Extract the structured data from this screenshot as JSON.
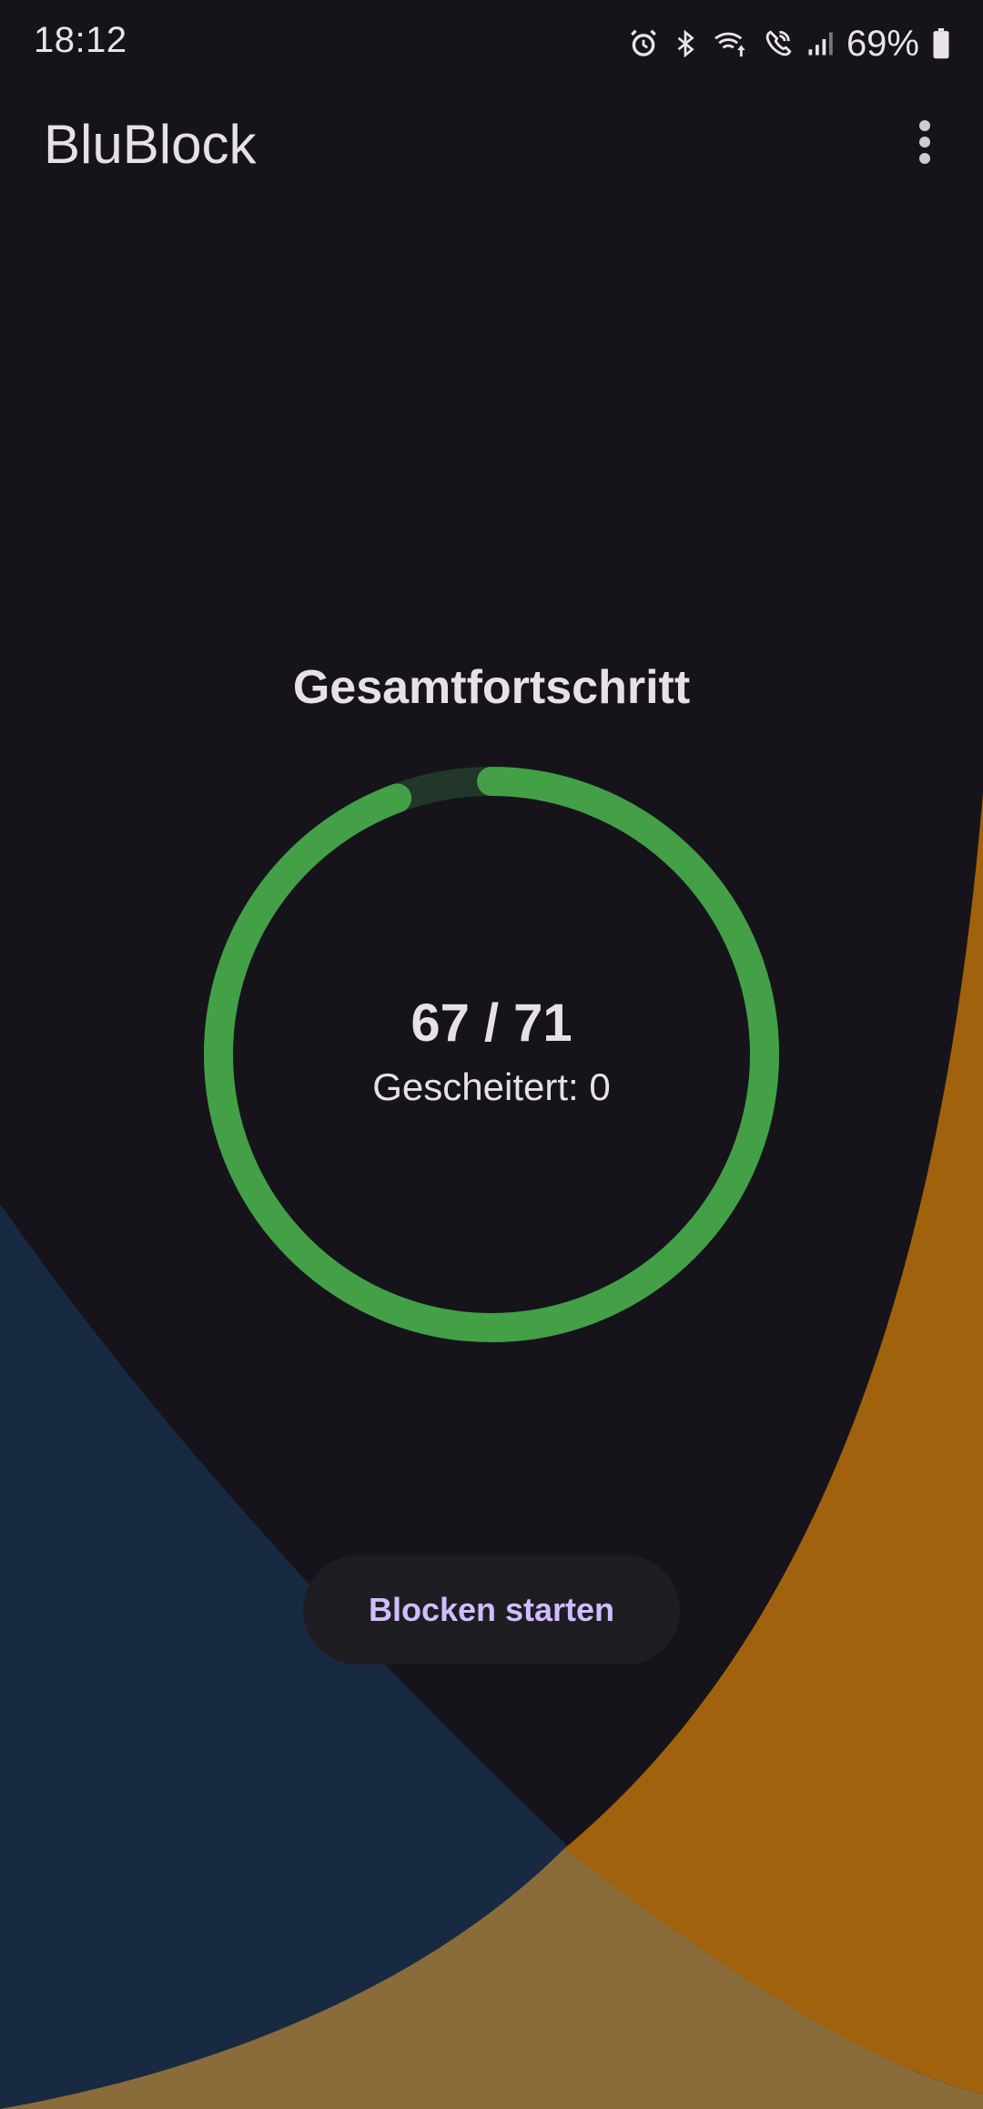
{
  "status_bar": {
    "time": "18:12",
    "battery_percent": "69%",
    "icons": [
      "alarm-icon",
      "bluetooth-icon",
      "wifi-calling-icon",
      "volte-call-icon",
      "signal-icon",
      "battery-icon"
    ]
  },
  "app_bar": {
    "title": "BluBlock",
    "menu_icon": "more-vert-icon"
  },
  "progress": {
    "title": "Gesamtfortschritt",
    "count": "67 / 71",
    "failed": "Gescheitert: 0",
    "completed": 67,
    "total": 71,
    "color": "#43a047",
    "track_color": "#22362a"
  },
  "actions": {
    "start_label": "Blocken starten"
  },
  "colors": {
    "background": "#16141a",
    "left_wave": "#172a42",
    "right_wave": "#a0620c",
    "bottom_wave": "#8a6c3b",
    "button_text": "#d2bcfd"
  }
}
